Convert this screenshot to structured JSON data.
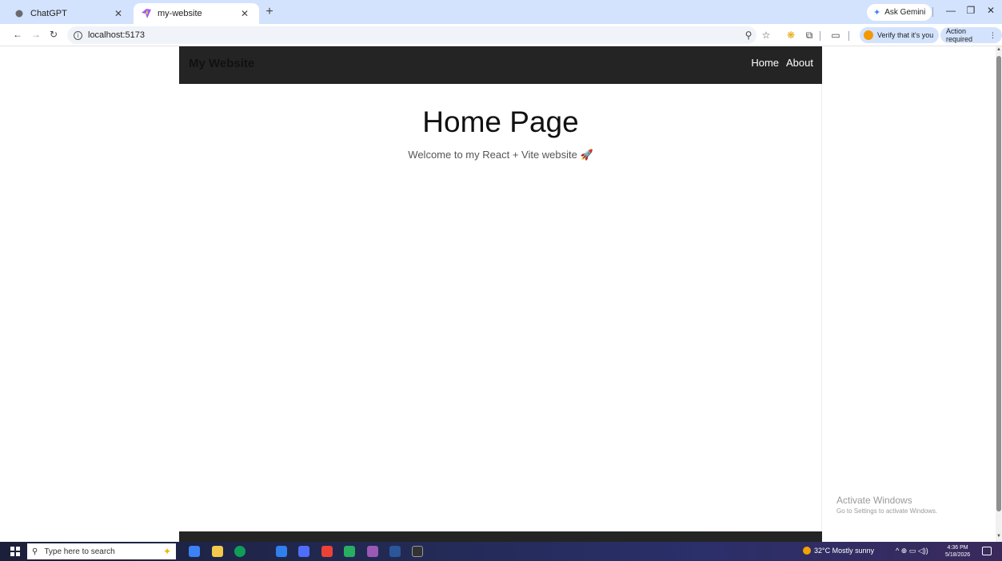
{
  "browser": {
    "tabs": [
      {
        "title": "ChatGPT",
        "icon": "chatgpt-icon"
      },
      {
        "title": "my-website",
        "icon": "vite-icon"
      }
    ],
    "new_tab_label": "+",
    "ask_gemini": "Ask Gemini",
    "address": "localhost:5173",
    "verify_label": "Verify that it's you",
    "action_required": "Action required"
  },
  "site": {
    "brand": "My Website",
    "nav_links": [
      "Home",
      "About"
    ],
    "hero_title": "Home Page",
    "hero_subtitle": "Welcome to my React + Vite website 🚀"
  },
  "watermark": {
    "title": "Activate Windows",
    "subtitle": "Go to Settings to activate Windows."
  },
  "taskbar": {
    "search_placeholder": "Type here to search",
    "weather": "32°C  Mostly sunny",
    "time": "4:36 PM",
    "date": "5/18/2026"
  },
  "colors": {
    "tabstrip": "#d3e3fd",
    "site_nav": "#242424",
    "accent_orange": "#f29900"
  }
}
